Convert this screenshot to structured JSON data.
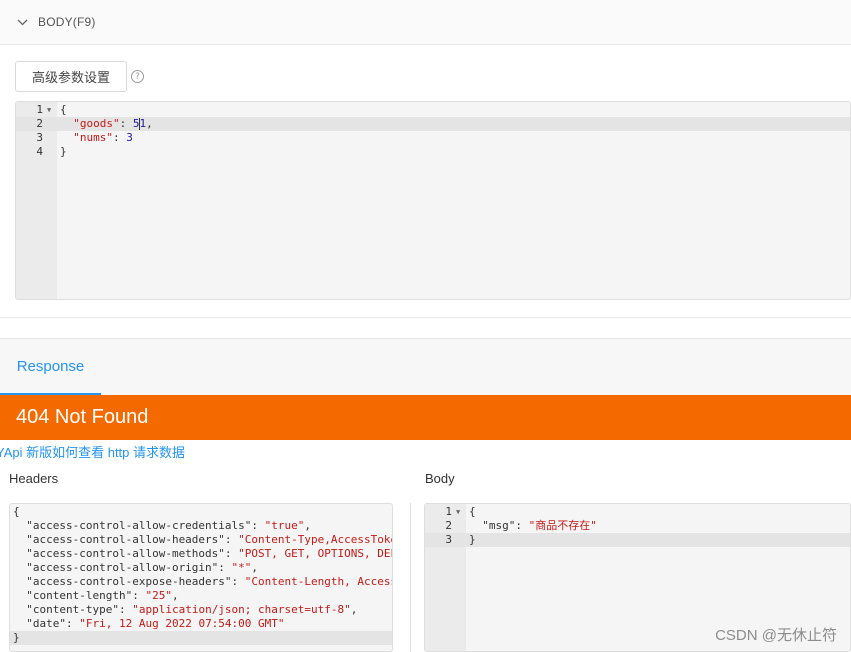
{
  "section": {
    "title": "BODY(F9)"
  },
  "advanced_button": {
    "label": "高级参数设置"
  },
  "help_icon": {
    "glyph": "?"
  },
  "request_body": {
    "lines": [
      {
        "n": "1",
        "fold": "▼",
        "parts": [
          {
            "t": "{",
            "c": "plain"
          }
        ]
      },
      {
        "n": "2",
        "parts": [
          {
            "t": "  ",
            "c": "plain"
          },
          {
            "t": "\"goods\"",
            "c": "str"
          },
          {
            "t": ": ",
            "c": "plain"
          },
          {
            "t": "5",
            "c": "num"
          },
          {
            "t": "|",
            "c": "cursor"
          },
          {
            "t": "1",
            "c": "num"
          },
          {
            "t": ",",
            "c": "plain"
          }
        ]
      },
      {
        "n": "3",
        "parts": [
          {
            "t": "  ",
            "c": "plain"
          },
          {
            "t": "\"nums\"",
            "c": "str"
          },
          {
            "t": ": ",
            "c": "plain"
          },
          {
            "t": "3",
            "c": "num"
          }
        ]
      },
      {
        "n": "4",
        "parts": [
          {
            "t": "}",
            "c": "plain"
          }
        ]
      }
    ],
    "active_line": 1
  },
  "response_tab": {
    "label": "Response"
  },
  "status": {
    "text": "404 Not Found",
    "color": "#f56a00"
  },
  "doc_link": {
    "text": "YApi 新版如何查看 http 请求数据"
  },
  "headers_panel": {
    "label": "Headers",
    "lines": [
      {
        "parts": [
          {
            "t": "{",
            "c": "plain"
          }
        ]
      },
      {
        "parts": [
          {
            "t": "  \"access-control-allow-credentials\": ",
            "c": "plain"
          },
          {
            "t": "\"true\"",
            "c": "str"
          },
          {
            "t": ",",
            "c": "plain"
          }
        ]
      },
      {
        "parts": [
          {
            "t": "  \"access-control-allow-headers\": ",
            "c": "plain"
          },
          {
            "t": "\"Content-Type,AccessToke",
            "c": "str"
          }
        ]
      },
      {
        "parts": [
          {
            "t": "  \"access-control-allow-methods\": ",
            "c": "plain"
          },
          {
            "t": "\"POST, GET, OPTIONS, DEL",
            "c": "str"
          }
        ]
      },
      {
        "parts": [
          {
            "t": "  \"access-control-allow-origin\": ",
            "c": "plain"
          },
          {
            "t": "\"*\"",
            "c": "str"
          },
          {
            "t": ",",
            "c": "plain"
          }
        ]
      },
      {
        "parts": [
          {
            "t": "  \"access-control-expose-headers\": ",
            "c": "plain"
          },
          {
            "t": "\"Content-Length, Access",
            "c": "str"
          }
        ]
      },
      {
        "parts": [
          {
            "t": "  \"content-length\": ",
            "c": "plain"
          },
          {
            "t": "\"25\"",
            "c": "str"
          },
          {
            "t": ",",
            "c": "plain"
          }
        ]
      },
      {
        "parts": [
          {
            "t": "  \"content-type\": ",
            "c": "plain"
          },
          {
            "t": "\"application/json; charset=utf-8\"",
            "c": "str"
          },
          {
            "t": ",",
            "c": "plain"
          }
        ]
      },
      {
        "parts": [
          {
            "t": "  \"date\": ",
            "c": "plain"
          },
          {
            "t": "\"Fri, 12 Aug 2022 07:54:00 GMT\"",
            "c": "str"
          }
        ]
      },
      {
        "parts": [
          {
            "t": "}",
            "c": "plain"
          }
        ]
      }
    ],
    "active_line": 9
  },
  "body_panel": {
    "label": "Body",
    "lines": [
      {
        "n": "1",
        "fold": "▼",
        "parts": [
          {
            "t": "{",
            "c": "plain"
          }
        ]
      },
      {
        "n": "2",
        "parts": [
          {
            "t": "  \"msg\": ",
            "c": "plain"
          },
          {
            "t": "\"商品不存在\"",
            "c": "str"
          }
        ]
      },
      {
        "n": "3",
        "parts": [
          {
            "t": "}",
            "c": "plain"
          }
        ]
      }
    ],
    "active_line": 2
  },
  "watermark": {
    "text": "CSDN @无休止符"
  }
}
